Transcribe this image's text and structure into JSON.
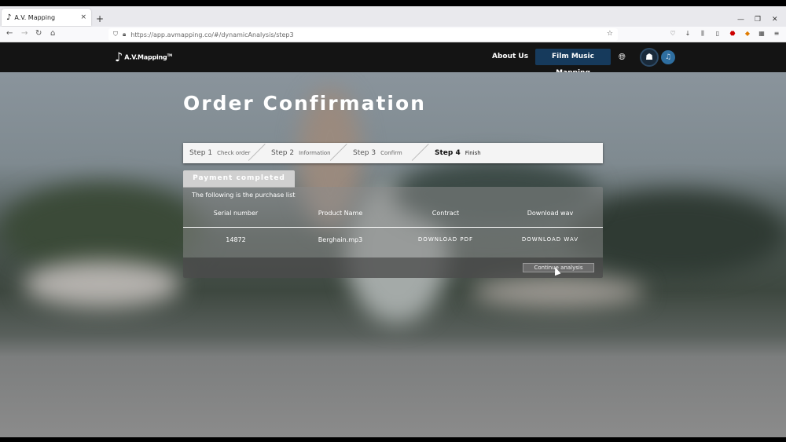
{
  "browser": {
    "tab_title": "A.V. Mapping",
    "tab_close": "×",
    "new_tab": "+",
    "url": "https://app.avmapping.co/#/dynamicAnalysis/step3"
  },
  "site": {
    "logo_mark": "♪",
    "logo_text": "A.V.Mapping",
    "logo_tm": "TM",
    "nav_about": "About Us",
    "nav_fmm": "Film Music Mapping"
  },
  "page": {
    "title": "Order Confirmation"
  },
  "steps": [
    {
      "num": "Step 1",
      "label": "Check order"
    },
    {
      "num": "Step 2",
      "label": "Information"
    },
    {
      "num": "Step 3",
      "label": "Confirm"
    },
    {
      "num": "Step 4",
      "label": "Finish"
    }
  ],
  "payment": {
    "tab_label": "Payment completed",
    "intro": "The following is the purchase list",
    "columns": [
      "Serial number",
      "Product Name",
      "Contract",
      "Download wav"
    ],
    "row": {
      "serial": "14872",
      "product": "Berghain.mp3",
      "contract": "DOWNLOAD PDF",
      "download": "DOWNLOAD WAV"
    },
    "continue_label": "Continue analysis"
  },
  "colors": {
    "header_bg": "#141414",
    "accent_button": "#163a5c",
    "avatar_accent": "#2e6ea0"
  },
  "icons": {
    "tab_favicon": "music-note-icon",
    "globe": "globe-icon",
    "avatar": "user-avatar-icon",
    "music": "music-note-icon"
  }
}
